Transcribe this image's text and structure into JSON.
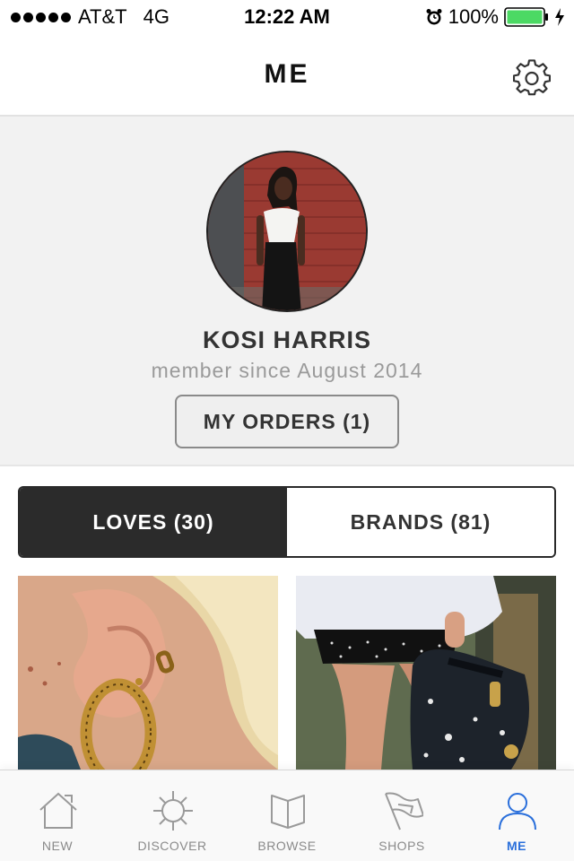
{
  "status_bar": {
    "carrier": "AT&T",
    "network": "4G",
    "time": "12:22 AM",
    "battery": "100%",
    "battery_color": "#4cd964",
    "icons": [
      "signal-dots-icon",
      "alarm-icon",
      "battery-icon",
      "charging-icon"
    ]
  },
  "nav": {
    "title": "ME",
    "settings_icon": "gear-icon"
  },
  "profile": {
    "name": "KOSI HARRIS",
    "member_since": "member since August 2014",
    "orders_button": "MY ORDERS (1)"
  },
  "segmented": {
    "loves": "LOVES (30)",
    "brands": "BRANDS (81)",
    "selected": "LOVES (30)"
  },
  "tab_bar": {
    "accent_color": "#2a6fdb",
    "items": [
      {
        "label": "NEW",
        "icon": "house-icon"
      },
      {
        "label": "DISCOVER",
        "icon": "compass-icon"
      },
      {
        "label": "BROWSE",
        "icon": "book-icon"
      },
      {
        "label": "SHOPS",
        "icon": "flag-icon"
      },
      {
        "label": "ME",
        "icon": "person-icon"
      }
    ],
    "active": "ME"
  }
}
